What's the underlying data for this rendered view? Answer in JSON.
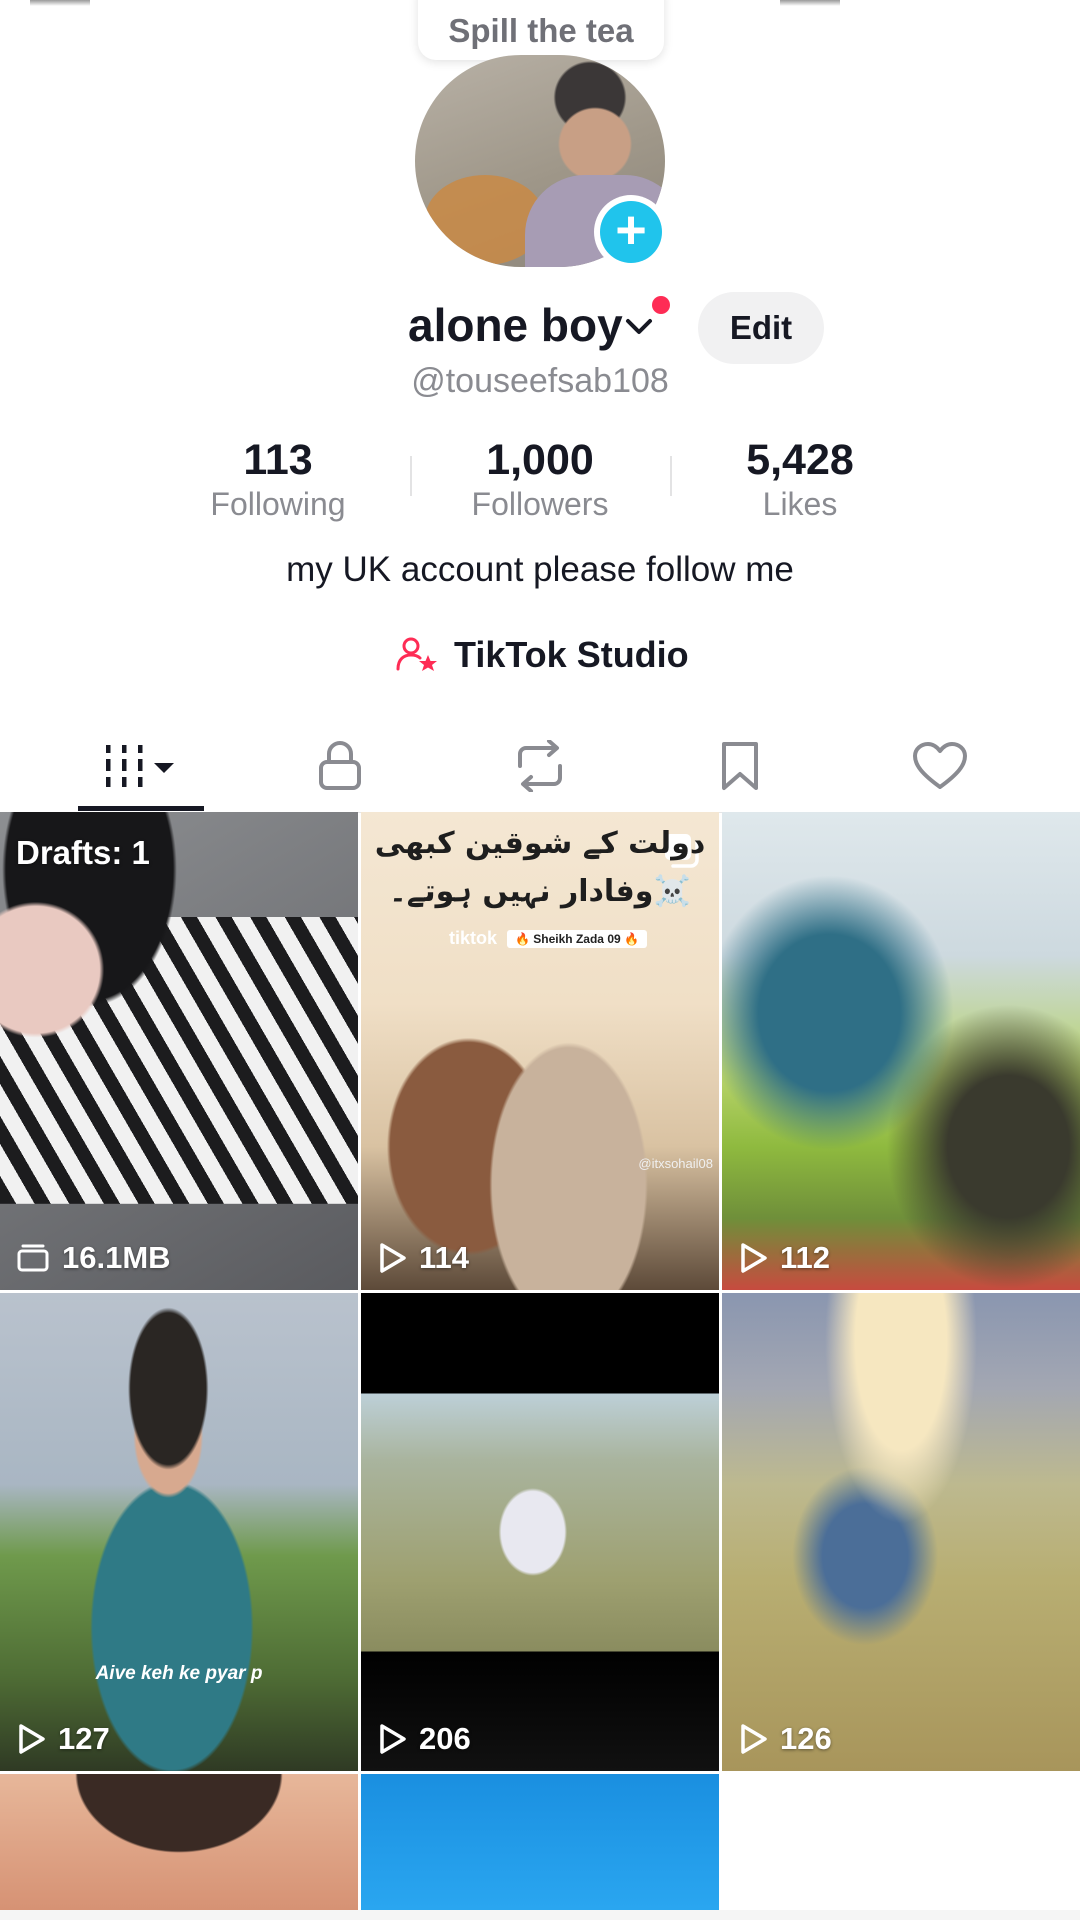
{
  "tooltip": {
    "text": "Spill the tea"
  },
  "profile": {
    "name": "alone boy",
    "handle": "@touseefsab108",
    "edit_label": "Edit",
    "bio": "my UK account please follow me",
    "studio_label": "TikTok Studio"
  },
  "stats": [
    {
      "value": "113",
      "label": "Following"
    },
    {
      "value": "1,000",
      "label": "Followers"
    },
    {
      "value": "5,428",
      "label": "Likes"
    }
  ],
  "tabs": [
    {
      "icon": "grid-videos-icon",
      "active": true
    },
    {
      "icon": "lock-icon",
      "active": false
    },
    {
      "icon": "repost-icon",
      "active": false
    },
    {
      "icon": "bookmark-icon",
      "active": false
    },
    {
      "icon": "heart-icon",
      "active": false
    }
  ],
  "grid": {
    "drafts_label": "Drafts: 1",
    "draft_size": "16.1MB",
    "tile2_text_line1": "دولت کے شوقین کبھی",
    "tile2_text_line2": "وفادار نہیں ہوتے۔☠️",
    "tile2_tiktok": "tiktok",
    "tile2_tag": "🔥 Sheikh Zada 09 🔥",
    "tile2_watermark": "@itxsohail08",
    "tile4_caption": "Aive keh ke pyar p",
    "views": [
      "114",
      "112",
      "127",
      "206",
      "126"
    ]
  },
  "colors": {
    "accent": "#fe2c55",
    "add_button": "#20c4ec",
    "muted_text": "#8a8b91"
  }
}
